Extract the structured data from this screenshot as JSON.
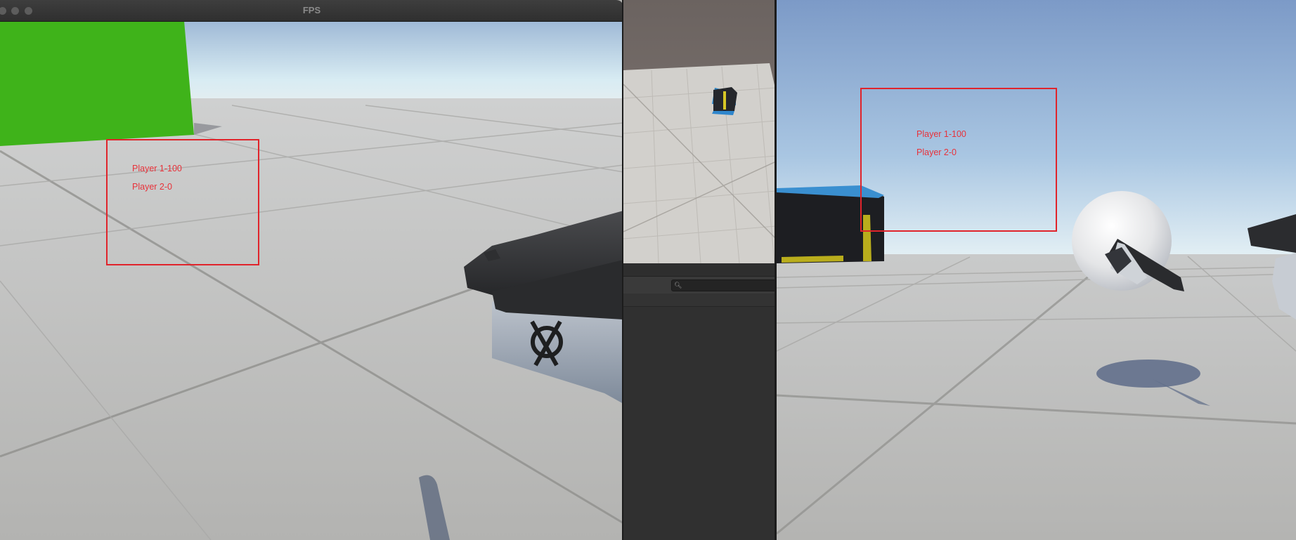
{
  "fps_window": {
    "title": "FPS",
    "hud": {
      "player1_score": "Player 1-100",
      "player2_score": "Player 2-0"
    }
  },
  "game_window": {
    "hud": {
      "player1_score": "Player 1-100",
      "player2_score": "Player 2-0"
    }
  },
  "scene_window": {
    "search": {
      "placeholder": ""
    },
    "search_icon": "search-icon"
  },
  "colors": {
    "hud_red": "#e0242b",
    "green_wall": "#3fb31a",
    "sky_blue": "#7b9ac8",
    "floor_gray": "#b9b9b7"
  }
}
